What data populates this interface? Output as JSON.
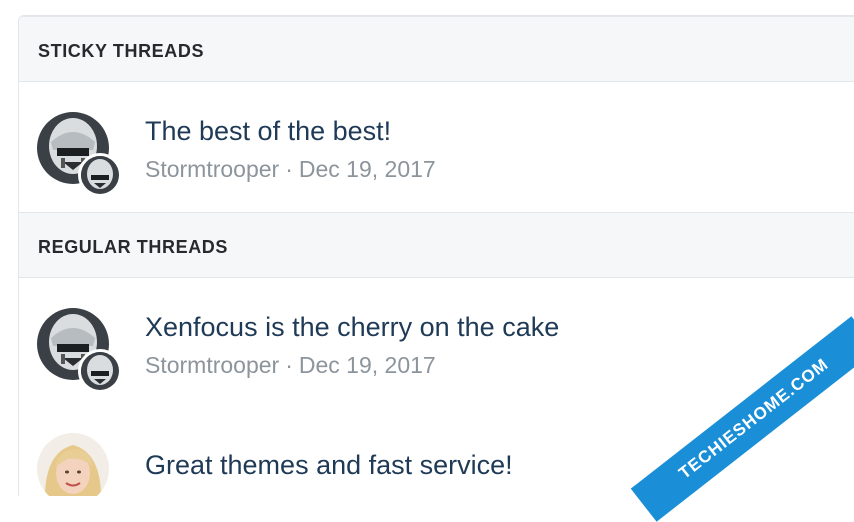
{
  "sections": [
    {
      "header": "STICKY THREADS",
      "threads": [
        {
          "title": "The best of the best!",
          "author": "Stormtrooper",
          "separator": "·",
          "date": "Dec 19, 2017",
          "avatar": "stormtrooper-avatar"
        }
      ]
    },
    {
      "header": "REGULAR THREADS",
      "threads": [
        {
          "title": "Xenfocus is the cherry on the cake",
          "author": "Stormtrooper",
          "separator": "·",
          "date": "Dec 19, 2017",
          "avatar": "stormtrooper-avatar"
        },
        {
          "title": "Great themes and fast service!",
          "avatar": "blonde-woman-avatar"
        }
      ]
    }
  ],
  "watermark": "TECHIESHOME.COM",
  "colors": {
    "title": "#1f3a56",
    "meta": "#8c949c",
    "header_bg": "#f6f7f9",
    "watermark": "#1a8fd8"
  }
}
